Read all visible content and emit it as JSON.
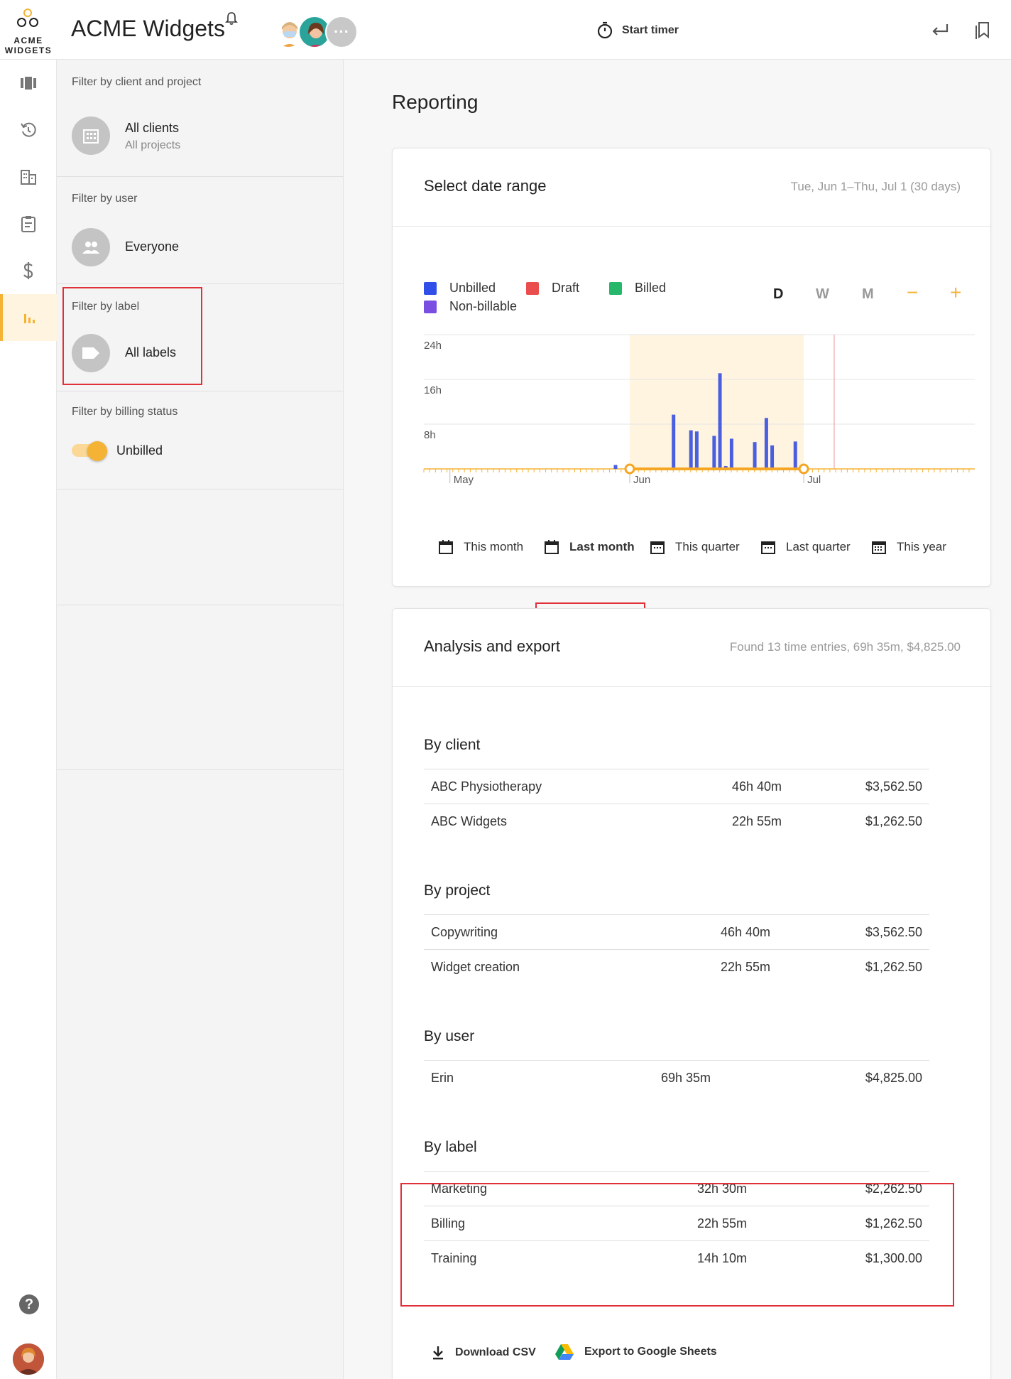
{
  "app": {
    "logo_line1": "ACME",
    "logo_line2": "WIDGETS",
    "title": "ACME Widgets",
    "start_timer": "Start timer",
    "more_avatars": "···"
  },
  "rail": {
    "icons": [
      "timeline-icon",
      "history-icon",
      "clients-building-icon",
      "clipboard-icon",
      "dollar-icon",
      "reporting-bar-chart-icon"
    ],
    "active": "reporting-bar-chart-icon"
  },
  "filters": {
    "client_project": {
      "title": "Filter by client and project",
      "main": "All clients",
      "sub": "All projects"
    },
    "user": {
      "title": "Filter by user",
      "main": "Everyone"
    },
    "label": {
      "title": "Filter by label",
      "main": "All labels"
    },
    "billing": {
      "title": "Filter by billing status",
      "main": "Unbilled",
      "enabled": true
    }
  },
  "page": {
    "title": "Reporting"
  },
  "date_range": {
    "title": "Select date range",
    "meta": "Tue, Jun 1–Thu, Jul 1 (30 days)",
    "legend": [
      {
        "label": "Unbilled",
        "color": "#2f4fe8"
      },
      {
        "label": "Draft",
        "color": "#ea4d4d"
      },
      {
        "label": "Billed",
        "color": "#25b86a"
      },
      {
        "label": "Non-billable",
        "color": "#7a4ee0"
      }
    ],
    "zoom": {
      "day": "D",
      "week": "W",
      "month": "M",
      "minus": "−",
      "plus": "+"
    },
    "presets": [
      "This month",
      "Last month",
      "This quarter",
      "Last quarter",
      "This year"
    ],
    "selected_preset": "Last month"
  },
  "chart_data": {
    "type": "bar",
    "y_ticks": [
      "24h",
      "16h",
      "8h"
    ],
    "x_ticks": [
      "May",
      "Jun",
      "Jul"
    ],
    "ylim": [
      0,
      24
    ],
    "unit": "hours",
    "selection": {
      "start": "Jun 1",
      "end": "Jul 1"
    },
    "series": [
      {
        "color": "#4a5fe0",
        "points": [
          {
            "day": -3,
            "value": 0.7
          },
          {
            "day": 7,
            "value": 9.7
          },
          {
            "day": 10,
            "value": 6.9
          },
          {
            "day": 11,
            "value": 6.7
          },
          {
            "day": 14,
            "value": 5.9
          },
          {
            "day": 15,
            "value": 17.1
          },
          {
            "day": 16,
            "value": 0.5
          },
          {
            "day": 17,
            "value": 5.4
          },
          {
            "day": 21,
            "value": 4.8
          },
          {
            "day": 23,
            "value": 9.1
          },
          {
            "day": 24,
            "value": 4.2
          },
          {
            "day": 28,
            "value": 4.9
          }
        ]
      }
    ]
  },
  "analysis": {
    "title": "Analysis and export",
    "meta": "Found 13 time entries, 69h 35m, $4,825.00",
    "by_client": {
      "title": "By client",
      "rows": [
        {
          "name": "ABC Physiotherapy",
          "time": "46h 40m",
          "amount": "$3,562.50"
        },
        {
          "name": "ABC Widgets",
          "time": "22h 55m",
          "amount": "$1,262.50"
        }
      ]
    },
    "by_project": {
      "title": "By project",
      "rows": [
        {
          "name": "Copywriting",
          "time": "46h 40m",
          "amount": "$3,562.50"
        },
        {
          "name": "Widget creation",
          "time": "22h 55m",
          "amount": "$1,262.50"
        }
      ]
    },
    "by_user": {
      "title": "By user",
      "rows": [
        {
          "name": "Erin",
          "time": "69h 35m",
          "amount": "$4,825.00"
        }
      ]
    },
    "by_label": {
      "title": "By label",
      "rows": [
        {
          "name": "Marketing",
          "time": "32h 30m",
          "amount": "$2,262.50"
        },
        {
          "name": "Billing",
          "time": "22h 55m",
          "amount": "$1,262.50"
        },
        {
          "name": "Training",
          "time": "14h 10m",
          "amount": "$1,300.00"
        }
      ]
    },
    "download_csv": "Download CSV",
    "export_sheets": "Export to Google Sheets"
  }
}
